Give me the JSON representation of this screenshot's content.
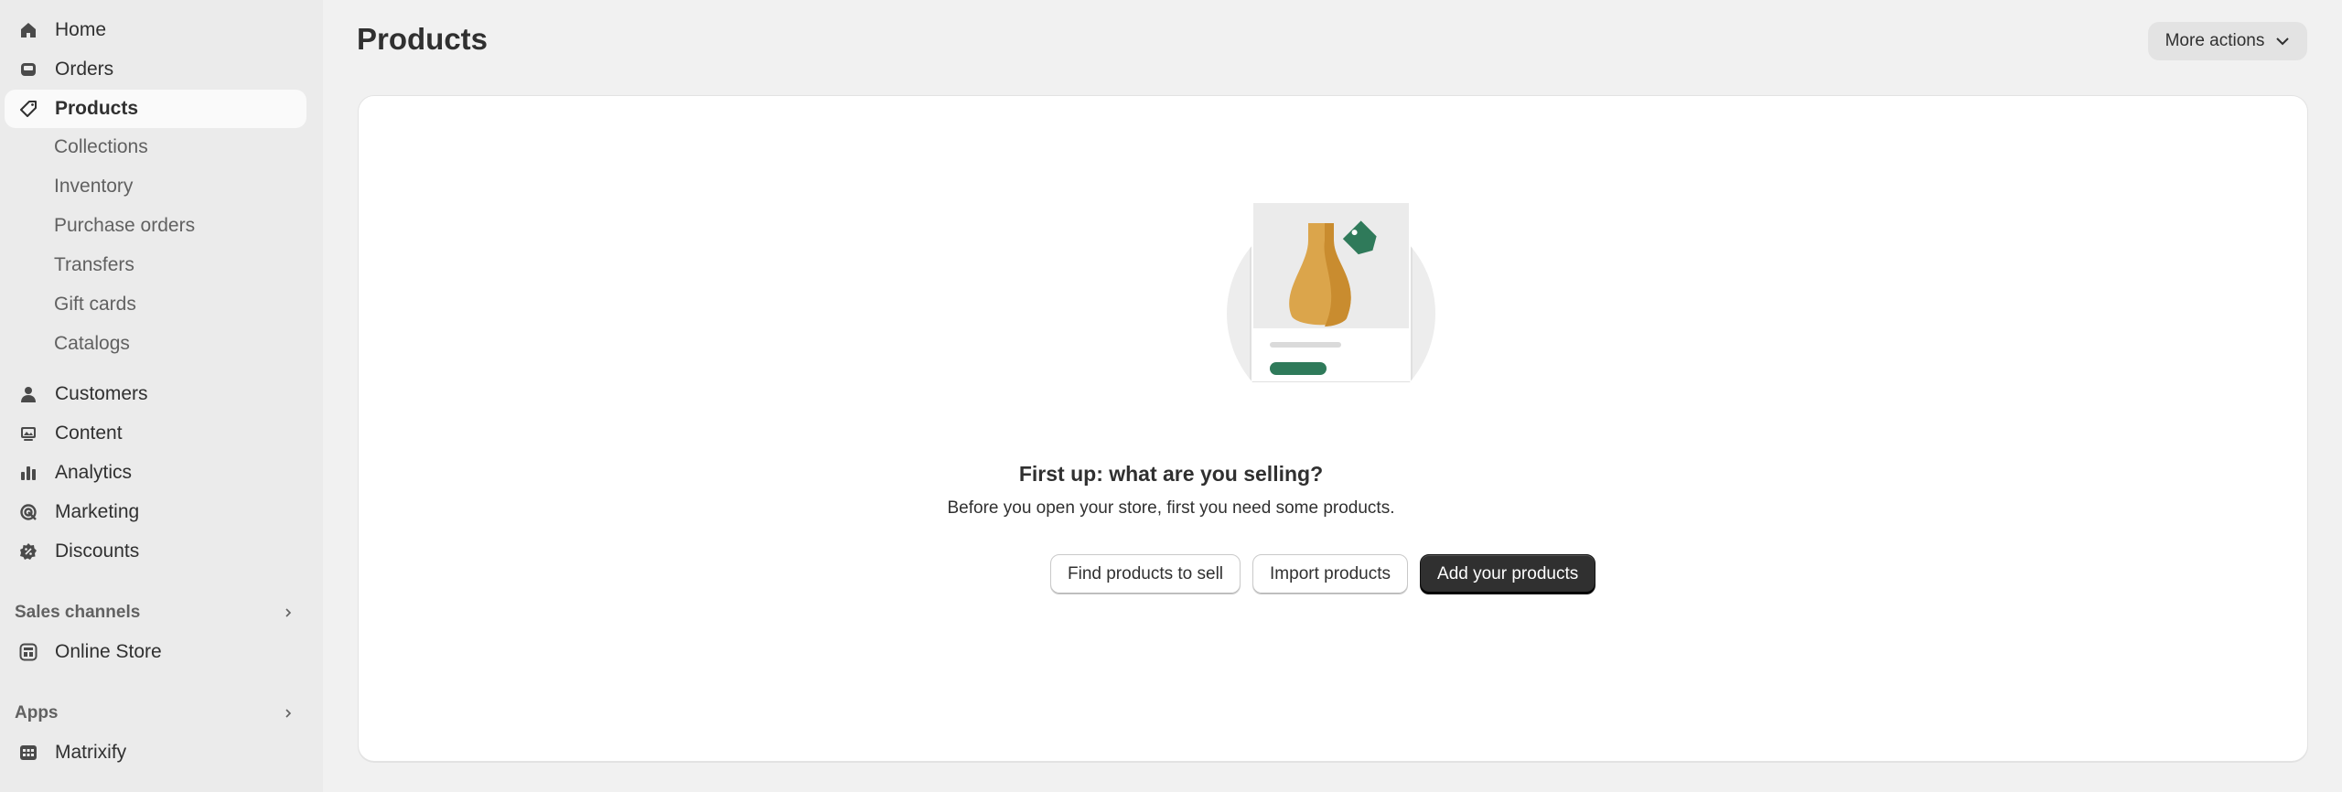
{
  "sidebar": {
    "primary": [
      {
        "label": "Home",
        "icon": "home-icon"
      },
      {
        "label": "Orders",
        "icon": "inbox-icon"
      },
      {
        "label": "Products",
        "icon": "tag-icon"
      }
    ],
    "products_sub": [
      {
        "label": "Collections"
      },
      {
        "label": "Inventory"
      },
      {
        "label": "Purchase orders"
      },
      {
        "label": "Transfers"
      },
      {
        "label": "Gift cards"
      },
      {
        "label": "Catalogs"
      }
    ],
    "secondary": [
      {
        "label": "Customers",
        "icon": "person-icon"
      },
      {
        "label": "Content",
        "icon": "image-icon"
      },
      {
        "label": "Analytics",
        "icon": "bar-chart-icon"
      },
      {
        "label": "Marketing",
        "icon": "target-icon"
      },
      {
        "label": "Discounts",
        "icon": "discount-icon"
      }
    ],
    "sales_channels": {
      "header": "Sales channels",
      "items": [
        {
          "label": "Online Store",
          "icon": "store-icon"
        }
      ]
    },
    "apps": {
      "header": "Apps",
      "items": [
        {
          "label": "Matrixify",
          "icon": "app-icon"
        }
      ]
    }
  },
  "header": {
    "title": "Products",
    "more_actions": "More actions"
  },
  "empty_state": {
    "heading": "First up: what are you selling?",
    "body": "Before you open your store, first you need some products.",
    "find_button": "Find products to sell",
    "import_button": "Import products",
    "add_button": "Add your products"
  },
  "colors": {
    "sidebar_bg": "#ebebeb",
    "page_bg": "#f1f1f1",
    "primary_button": "#303030",
    "tag_green": "#2f7a5a",
    "vase_orange": "#d99a3d"
  }
}
